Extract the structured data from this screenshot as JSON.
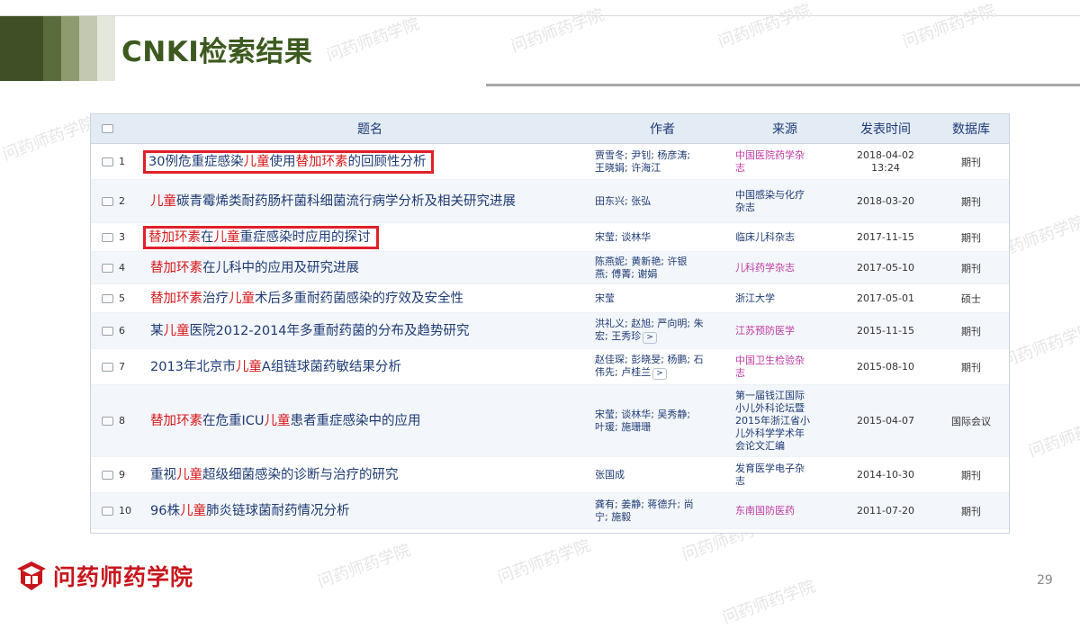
{
  "slide": {
    "title": "CNKI检索结果",
    "page_number": "29",
    "logo_text": "问药师药学院",
    "watermark_text": "问药师药学院",
    "colors": {
      "title": "#3c5a1e",
      "accent_red": "#d7191c",
      "link_blue": "#1f3b75",
      "source_pink": "#c03aa3"
    },
    "header_bar_colors": [
      "#3f5027",
      "#5b6c3c",
      "#8e9b6e",
      "#c3c9b0",
      "#e4e7dc"
    ]
  },
  "table": {
    "headers": {
      "title": "题名",
      "author": "作者",
      "source": "来源",
      "date": "发表时间",
      "database": "数据库"
    },
    "rows": [
      {
        "num": "1",
        "title": [
          {
            "t": "30例危重症感染"
          },
          {
            "t": "儿童",
            "hl": true
          },
          {
            "t": "使用"
          },
          {
            "t": "替加环素",
            "hl": true
          },
          {
            "t": "的回顾性分析"
          }
        ],
        "boxed": true,
        "authors": [
          "贾雪冬; 尹钊; 杨彦涛;",
          "王晓娟; 许海江"
        ],
        "source": [
          "中国医院药学杂",
          "志"
        ],
        "source_color": "pink",
        "date": [
          "2018-04-02",
          "13:24"
        ],
        "database": "期刊"
      },
      {
        "num": "2",
        "title": [
          {
            "t": "儿童",
            "hl": true
          },
          {
            "t": "碳青霉烯类耐药肠杆菌科细菌流行病学分析及相关研究进展"
          }
        ],
        "boxed": false,
        "authors": [
          "田东兴; 张弘"
        ],
        "source": [
          "中国感染与化疗",
          "杂志"
        ],
        "source_color": "blue",
        "date": [
          "2018-03-20"
        ],
        "database": "期刊"
      },
      {
        "num": "3",
        "title": [
          {
            "t": "替加环素",
            "hl": true
          },
          {
            "t": "在"
          },
          {
            "t": "儿童",
            "hl": true
          },
          {
            "t": "重症感染时应用的探讨"
          }
        ],
        "boxed": true,
        "authors": [
          "宋莹; 谈林华"
        ],
        "source": [
          "临床儿科杂志"
        ],
        "source_color": "blue",
        "date": [
          "2017-11-15"
        ],
        "database": "期刊"
      },
      {
        "num": "4",
        "title": [
          {
            "t": "替加环素",
            "hl": true
          },
          {
            "t": "在儿科中的应用及研究进展"
          }
        ],
        "boxed": false,
        "authors": [
          "陈燕妮; 黄新艳; 许银",
          "燕; 傅菁; 谢娟"
        ],
        "source": [
          "儿科药学杂志"
        ],
        "source_color": "pink",
        "date": [
          "2017-05-10"
        ],
        "database": "期刊"
      },
      {
        "num": "5",
        "title": [
          {
            "t": "替加环素",
            "hl": true
          },
          {
            "t": "治疗"
          },
          {
            "t": "儿童",
            "hl": true
          },
          {
            "t": "术后多重耐药菌感染的疗效及安全性"
          }
        ],
        "boxed": false,
        "authors": [
          "宋莹"
        ],
        "source": [
          "浙江大学"
        ],
        "source_color": "blue",
        "date": [
          "2017-05-01"
        ],
        "database": "硕士"
      },
      {
        "num": "6",
        "title": [
          {
            "t": "某"
          },
          {
            "t": "儿童",
            "hl": true
          },
          {
            "t": "医院2012-2014年多重耐药菌的分布及趋势研究"
          }
        ],
        "boxed": false,
        "authors": [
          "洪礼义; 赵旭; 严向明; 朱",
          "宏; 王秀珍"
        ],
        "more": ">",
        "source": [
          "江苏预防医学"
        ],
        "source_color": "pink",
        "date": [
          "2015-11-15"
        ],
        "database": "期刊"
      },
      {
        "num": "7",
        "title": [
          {
            "t": "2013年北京市"
          },
          {
            "t": "儿童",
            "hl": true
          },
          {
            "t": "A组链球菌药敏结果分析"
          }
        ],
        "boxed": false,
        "authors": [
          "赵佳琛; 彭晓旻; 杨鹏; 石",
          "伟先; 卢桂兰"
        ],
        "more": ">",
        "source": [
          "中国卫生检验杂",
          "志"
        ],
        "source_color": "pink",
        "date": [
          "2015-08-10"
        ],
        "database": "期刊"
      },
      {
        "num": "8",
        "title": [
          {
            "t": "替加环素",
            "hl": true
          },
          {
            "t": "在危重ICU"
          },
          {
            "t": "儿童",
            "hl": true
          },
          {
            "t": "患者重症感染中的应用"
          }
        ],
        "boxed": false,
        "authors": [
          "宋莹; 谈林华; 吴秀静;",
          "叶瑗; 施珊珊"
        ],
        "source": [
          "第一届钱江国际",
          "小儿外科论坛暨",
          "2015年浙江省小",
          "儿外科学学术年",
          "会论文汇编"
        ],
        "source_color": "blue",
        "date": [
          "2015-04-07"
        ],
        "database": "国际会议"
      },
      {
        "num": "9",
        "title": [
          {
            "t": "重视"
          },
          {
            "t": "儿童",
            "hl": true
          },
          {
            "t": "超级细菌感染的诊断与治疗的研究"
          }
        ],
        "boxed": false,
        "authors": [
          "张国成"
        ],
        "source": [
          "发育医学电子杂",
          "志"
        ],
        "source_color": "blue",
        "date": [
          "2014-10-30"
        ],
        "database": "期刊"
      },
      {
        "num": "10",
        "title": [
          {
            "t": "96株"
          },
          {
            "t": "儿童",
            "hl": true
          },
          {
            "t": "肺炎链球菌耐药情况分析"
          }
        ],
        "boxed": false,
        "authors": [
          "龚有; 姜静; 蒋德升; 尚",
          "宁; 施毅"
        ],
        "source": [
          "东南国防医药"
        ],
        "source_color": "pink",
        "date": [
          "2011-07-20"
        ],
        "database": "期刊"
      }
    ]
  }
}
